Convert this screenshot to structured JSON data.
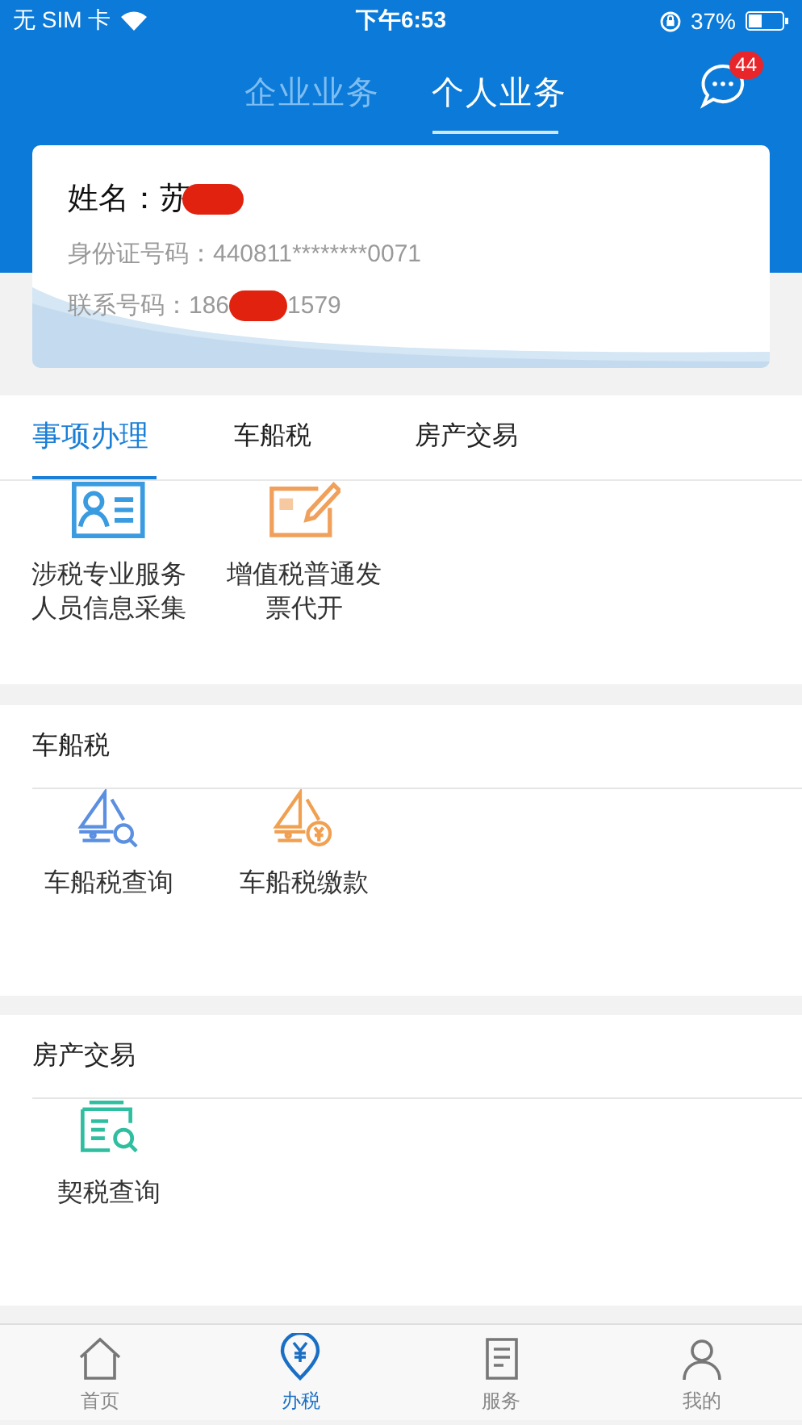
{
  "status_bar": {
    "carrier": "无 SIM 卡",
    "time": "下午6:53",
    "battery": "37%"
  },
  "header": {
    "tabs": [
      {
        "label": "企业业务",
        "selected": false
      },
      {
        "label": "个人业务",
        "selected": true
      }
    ],
    "messages_badge": "44"
  },
  "profile": {
    "name_label": "姓名：",
    "name": "苏",
    "id_label": "身份证号码：",
    "id_number": "440811********0071",
    "phone_label": "联系号码：",
    "phone_prefix": "186",
    "phone_suffix": "1579"
  },
  "category_tabs": [
    {
      "label": "事项办理",
      "selected": true
    },
    {
      "label": "车船税",
      "selected": false
    },
    {
      "label": "房产交易",
      "selected": false
    }
  ],
  "category_items": [
    {
      "kind": "id-card",
      "label": "涉税专业服务人员信息采集"
    },
    {
      "kind": "invoice",
      "label": "增值税普通发票代开"
    }
  ],
  "sections": [
    {
      "title": "车船税",
      "items": [
        {
          "kind": "boat-search",
          "label": "车船税查询"
        },
        {
          "kind": "boat-pay",
          "label": "车船税缴款"
        }
      ]
    },
    {
      "title": "房产交易",
      "items": [
        {
          "kind": "doc-search",
          "label": "契税查询"
        }
      ]
    }
  ],
  "bottom_nav": [
    {
      "kind": "home",
      "label": "首页",
      "selected": false
    },
    {
      "kind": "tax",
      "label": "办税",
      "selected": true
    },
    {
      "kind": "service",
      "label": "服务",
      "selected": false
    },
    {
      "kind": "user",
      "label": "我的",
      "selected": false
    }
  ]
}
